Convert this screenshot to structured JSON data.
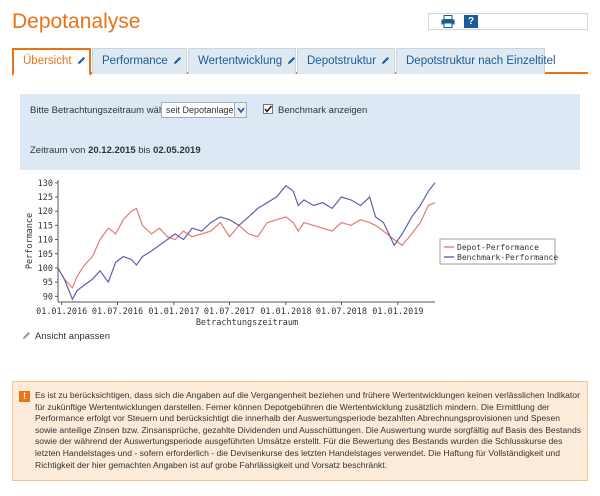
{
  "header": {
    "title": "Depotanalyse"
  },
  "tabs": [
    {
      "label": "Übersicht",
      "active": true
    },
    {
      "label": "Performance"
    },
    {
      "label": "Wertentwicklung"
    },
    {
      "label": "Depotstruktur"
    },
    {
      "label": "Depotstruktur nach Einzeltitel"
    }
  ],
  "filter": {
    "period_label": "Bitte Betrachtungszeitraum wählen:",
    "period_value": "seit Depotanlage",
    "benchmark_label": "Benchmark anzeigen",
    "benchmark_checked": true,
    "zeitraum_prefix": "Zeitraum von",
    "zeitraum_from": "20.12.2015",
    "zeitraum_mid": "bis",
    "zeitraum_to": "02.05.2019"
  },
  "chart_data": {
    "type": "line",
    "xlabel": "Betrachtungszeitraum",
    "ylabel": "Performance",
    "ylim": [
      88,
      131
    ],
    "xlim": [
      "2015-12-20",
      "2019-05-02"
    ],
    "yticks": [
      90,
      95,
      100,
      105,
      110,
      115,
      120,
      125,
      130
    ],
    "xticks": [
      "01.01.2016",
      "01.07.2016",
      "01.01.2017",
      "01.07.2017",
      "01.01.2018",
      "01.07.2018",
      "01.01.2019"
    ],
    "legend_position": "right",
    "series": [
      {
        "name": "Depot-Performance",
        "color": "#e07b73",
        "x": [
          "2015-12-20",
          "2016-01-10",
          "2016-02-05",
          "2016-02-20",
          "2016-03-15",
          "2016-04-10",
          "2016-05-05",
          "2016-06-01",
          "2016-06-25",
          "2016-07-20",
          "2016-08-15",
          "2016-09-01",
          "2016-09-20",
          "2016-10-20",
          "2016-11-15",
          "2016-12-10",
          "2017-01-05",
          "2017-02-01",
          "2017-03-01",
          "2017-04-01",
          "2017-05-01",
          "2017-06-01",
          "2017-07-01",
          "2017-08-01",
          "2017-09-01",
          "2017-10-01",
          "2017-11-01",
          "2017-12-01",
          "2018-01-01",
          "2018-01-25",
          "2018-02-10",
          "2018-03-01",
          "2018-04-01",
          "2018-05-01",
          "2018-06-01",
          "2018-07-01",
          "2018-08-01",
          "2018-09-01",
          "2018-10-01",
          "2018-10-20",
          "2018-11-15",
          "2018-12-20",
          "2019-01-15",
          "2019-02-15",
          "2019-03-15",
          "2019-04-10",
          "2019-05-02"
        ],
        "values": [
          100,
          96,
          93,
          97,
          101,
          104,
          110,
          114,
          112,
          117,
          120,
          121,
          115,
          112,
          114,
          111,
          110,
          113,
          111,
          112,
          113,
          116,
          111,
          115,
          112,
          111,
          116,
          117,
          118,
          116,
          113,
          116,
          115,
          114,
          113,
          116,
          115,
          117,
          116,
          115,
          113,
          110,
          108,
          112,
          116,
          122,
          123
        ]
      },
      {
        "name": "Benchmark-Performance",
        "color": "#5e5fb8",
        "x": [
          "2015-12-20",
          "2016-01-10",
          "2016-02-05",
          "2016-02-20",
          "2016-03-15",
          "2016-04-10",
          "2016-05-05",
          "2016-06-01",
          "2016-06-25",
          "2016-07-20",
          "2016-08-15",
          "2016-09-01",
          "2016-09-20",
          "2016-10-20",
          "2016-11-15",
          "2016-12-10",
          "2017-01-05",
          "2017-02-01",
          "2017-03-01",
          "2017-04-01",
          "2017-05-01",
          "2017-06-01",
          "2017-07-01",
          "2017-08-01",
          "2017-09-01",
          "2017-10-01",
          "2017-11-01",
          "2017-12-01",
          "2018-01-01",
          "2018-01-25",
          "2018-02-10",
          "2018-03-01",
          "2018-04-01",
          "2018-05-01",
          "2018-06-01",
          "2018-07-01",
          "2018-08-01",
          "2018-09-01",
          "2018-10-01",
          "2018-10-20",
          "2018-11-15",
          "2018-12-20",
          "2019-01-15",
          "2019-02-15",
          "2019-03-15",
          "2019-04-10",
          "2019-05-02"
        ],
        "values": [
          100,
          96,
          89,
          92,
          94,
          96,
          99,
          95,
          102,
          104,
          103,
          101,
          104,
          106,
          108,
          110,
          112,
          110,
          114,
          113,
          116,
          118,
          117,
          115,
          118,
          121,
          123,
          125,
          129,
          127,
          122,
          124,
          122,
          123,
          121,
          125,
          124,
          122,
          125,
          118,
          116,
          108,
          112,
          118,
          122,
          127,
          130
        ]
      }
    ]
  },
  "footer_link": {
    "label": "Ansicht anpassen"
  },
  "notice": {
    "text": "Es ist zu berücksichtigen, dass sich die Angaben auf die Vergangenheit beziehen und frühere Wertentwicklungen keinen verlässlichen Indikator für zukünftige Wertentwicklungen darstellen. Ferner können Depotgebühren die Wertentwicklung zusätzlich mindern. Die Ermittlung der Performance erfolgt vor Steuern und berücksichtigt die innerhalb der Auswertungsperiode bezahlten Abrechnungsprovisionen und Spesen sowie anteilige Zinsen bzw. Zinsansprüche, gezahlte Dividenden und Ausschüttungen. Die Auswertung wurde sorgfältig auf Basis des Bestands sowie der während der Auswertungsperiode ausgeführten Umsätze erstellt. Für die Bewertung des Bestands wurden die Schlusskurse des letzten Handelstages und - sofern erforderlich - die Devisenkurse des letzten Handelstages verwendet. Die Haftung für Vollständigkeit und Richtigkeit der hier gemachten Angaben ist auf grobe Fahrlässigkeit und Vorsatz beschränkt."
  },
  "icons": {
    "print": "print-icon",
    "help": "help-icon",
    "edit": "pencil-icon",
    "warning": "warning-icon"
  },
  "colors": {
    "accent": "#e8731a",
    "link": "#1a5b9a",
    "panel": "#dce8f3",
    "notice_bg": "#fcebd8"
  }
}
